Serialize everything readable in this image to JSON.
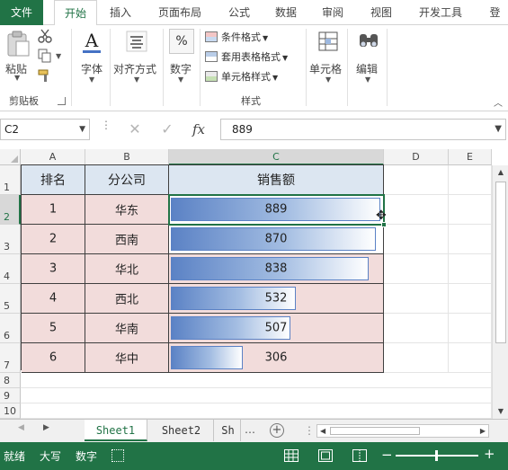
{
  "ribbon": {
    "tabs": [
      "文件",
      "开始",
      "插入",
      "页面布局",
      "公式",
      "数据",
      "审阅",
      "视图",
      "开发工具",
      "登"
    ],
    "active_tab": "开始",
    "groups": {
      "clipboard": {
        "paste": "粘贴",
        "group_label": "剪贴板"
      },
      "font": {
        "label": "字体"
      },
      "alignment": {
        "label": "对齐方式"
      },
      "number": {
        "label": "数字",
        "icon_text": "%"
      },
      "styles": {
        "conditional_format": "条件格式",
        "format_as_table": "套用表格格式",
        "cell_styles": "单元格样式",
        "group_label": "样式"
      },
      "cells": {
        "label": "单元格"
      },
      "editing": {
        "label": "编辑"
      }
    }
  },
  "formula_bar": {
    "name_box": "C2",
    "fx": "fx",
    "value": "889"
  },
  "columns": [
    "A",
    "B",
    "C",
    "D",
    "E"
  ],
  "selected_column": "C",
  "rows": [
    "1",
    "2",
    "3",
    "4",
    "5",
    "6",
    "7",
    "8",
    "9",
    "10"
  ],
  "selected_row": "2",
  "table": {
    "headers": [
      "排名",
      "分公司",
      "销售额"
    ],
    "rows": [
      {
        "rank": "1",
        "branch": "华东",
        "sales": "889"
      },
      {
        "rank": "2",
        "branch": "西南",
        "sales": "870"
      },
      {
        "rank": "3",
        "branch": "华北",
        "sales": "838"
      },
      {
        "rank": "4",
        "branch": "西北",
        "sales": "532"
      },
      {
        "rank": "5",
        "branch": "华南",
        "sales": "507"
      },
      {
        "rank": "6",
        "branch": "华中",
        "sales": "306"
      }
    ],
    "databar_max": 889,
    "databar_color": "#5b82c5"
  },
  "sheets": [
    "Sheet1",
    "Sheet2",
    "Sh"
  ],
  "active_sheet": "Sheet1",
  "status_bar": {
    "ready": "就绪",
    "caps": "大写",
    "num": "数字",
    "zoom_minus": "−",
    "zoom_plus": "+"
  },
  "colors": {
    "excel_green": "#217346",
    "header_fill": "#dce6f1",
    "row_fill": "#f2dcdb"
  }
}
